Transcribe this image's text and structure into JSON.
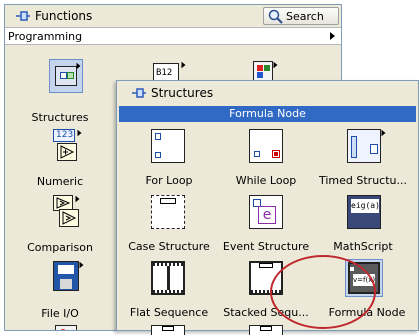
{
  "functions_palette": {
    "title": "Functions",
    "search_label": "Search",
    "category": "Programming",
    "items": [
      {
        "label": "Structures"
      },
      {
        "label": "Numeric"
      },
      {
        "label": "Comparison"
      },
      {
        "label": "File I/O"
      }
    ],
    "numeric_icon_text": "123"
  },
  "structures_palette": {
    "title": "Structures",
    "hover_tooltip": "Formula Node",
    "items": [
      {
        "label": "For Loop"
      },
      {
        "label": "While Loop"
      },
      {
        "label": "Timed Structu..."
      },
      {
        "label": "Case Structure"
      },
      {
        "label": "Event Structure"
      },
      {
        "label": "MathScript"
      },
      {
        "label": "Flat Sequence"
      },
      {
        "label": "Stacked Sequ..."
      },
      {
        "label": "Formula Node"
      }
    ],
    "formula_icon_text": "v=f(x)",
    "mathscript_icon_text": "eig(a)"
  },
  "colors": {
    "highlight": "#316ac5",
    "annotation_circle": "#c0282d"
  }
}
